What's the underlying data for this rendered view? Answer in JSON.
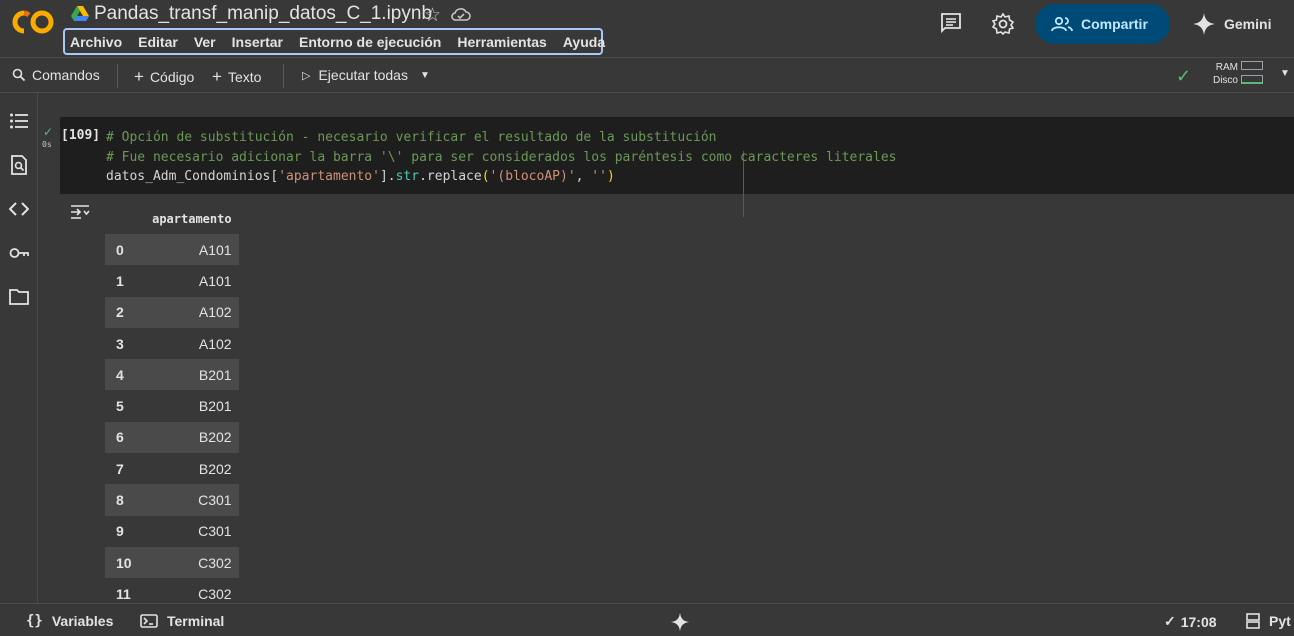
{
  "header": {
    "notebook_title": "Pandas_transf_manip_datos_C_1.ipynb",
    "menu": [
      "Archivo",
      "Editar",
      "Ver",
      "Insertar",
      "Entorno de ejecución",
      "Herramientas",
      "Ayuda"
    ],
    "share_label": "Compartir",
    "gemini_label": "Gemini",
    "accent_color": "#004a77"
  },
  "toolbar": {
    "commands": "Comandos",
    "code": "Código",
    "text": "Texto",
    "run_all": "Ejecutar todas",
    "ram_label": "RAM",
    "disk_label": "Disco"
  },
  "cell": {
    "exec_count": "[109]",
    "exec_time": "0s",
    "code_line1": "# Opción de substitución - necesario verificar el resultado de la substitución",
    "code_line2": "# Fue necesario adicionar la barra '\\' para ser considerados los paréntesis como caracteres literales",
    "code_line3": {
      "var": "datos_Adm_Condominios",
      "bracket_open": "[",
      "key": "'apartamento'",
      "bracket_close": "]",
      "dot1": ".",
      "str": "str",
      "dot2": ".",
      "method": "replace",
      "paren_open": "(",
      "arg1": "'(blocoAP)'",
      "comma": ", ",
      "arg2": "''",
      "paren_close": ")"
    }
  },
  "output": {
    "column": "apartamento",
    "rows": [
      {
        "index": "0",
        "value": "A101"
      },
      {
        "index": "1",
        "value": "A101"
      },
      {
        "index": "2",
        "value": "A102"
      },
      {
        "index": "3",
        "value": "A102"
      },
      {
        "index": "4",
        "value": "B201"
      },
      {
        "index": "5",
        "value": "B201"
      },
      {
        "index": "6",
        "value": "B202"
      },
      {
        "index": "7",
        "value": "B202"
      },
      {
        "index": "8",
        "value": "C301"
      },
      {
        "index": "9",
        "value": "C301"
      },
      {
        "index": "10",
        "value": "C302"
      },
      {
        "index": "11",
        "value": "C302"
      }
    ]
  },
  "statusbar": {
    "variables": "Variables",
    "terminal": "Terminal",
    "time": "17:08",
    "runtime": "Pyt"
  }
}
